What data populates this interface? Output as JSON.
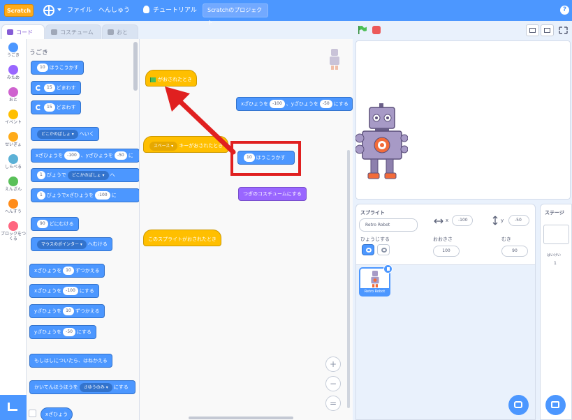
{
  "menu": {
    "logo": "Scratch",
    "file": "ファイル",
    "edit": "へんしゅう",
    "tutorials": "チュートリアル",
    "project_title": "Scratchのプロジェクト",
    "help": "?"
  },
  "tabs": {
    "code": "コード",
    "costumes": "コスチューム",
    "sounds": "おと"
  },
  "categories": [
    {
      "label": "うごき",
      "color": "#4c97ff"
    },
    {
      "label": "みため",
      "color": "#9966ff"
    },
    {
      "label": "おと",
      "color": "#cf63cf"
    },
    {
      "label": "イベント",
      "color": "#ffbf00"
    },
    {
      "label": "せいぎょ",
      "color": "#ffab19"
    },
    {
      "label": "しらべる",
      "color": "#5cb1d6"
    },
    {
      "label": "えんざん",
      "color": "#59c059"
    },
    {
      "label": "へんすう",
      "color": "#ff8c1a"
    },
    {
      "label": "ブロックをつくる",
      "color": "#ff6680"
    }
  ],
  "palette": {
    "title": "うごき",
    "move": {
      "value": "10",
      "text": "ほうこうかす"
    },
    "turn_right": {
      "value": "15",
      "text": "どまわす"
    },
    "turn_left": {
      "value": "15",
      "text": "どまわす"
    },
    "goto": {
      "dropdown": "どこかのばしょ ▾",
      "text": "へいく"
    },
    "goto_xy": {
      "t1": "xざひょうを",
      "x": "-100",
      "t2": "、yざひょうを",
      "y": "-50",
      "t3": "に"
    },
    "glide": {
      "value": "1",
      "t1": "びょうで",
      "dropdown": "どこかのばしょ ▾",
      "t2": "へ"
    },
    "glide_xy": {
      "value": "1",
      "t1": "びょうでxざひょうを",
      "x": "-100",
      "t2": "に"
    },
    "point_dir": {
      "value": "90",
      "text": "どにむける"
    },
    "point_towards": {
      "dropdown": "マウスのポインター ▾",
      "text": "へむける"
    },
    "change_x": {
      "t1": "xざひょうを",
      "value": "10",
      "t2": "ずつかえる"
    },
    "set_x": {
      "t1": "xざひょうを",
      "value": "-100",
      "t2": "にする"
    },
    "change_y": {
      "t1": "yざひょうを",
      "value": "10",
      "t2": "ずつかえる"
    },
    "set_y": {
      "t1": "yざひょうを",
      "value": "-50",
      "t2": "にする"
    },
    "bounce": "もしはしについたら、はねかえる",
    "rotation_style": {
      "t1": "かいてんほうほうを",
      "dropdown": "さゆうのみ ▾",
      "t2": "にする"
    },
    "x_reporter": "xざひょう"
  },
  "script": {
    "hat_flag": "がおされたとき",
    "goto_xy": {
      "t1": "xざひょうを",
      "x": "-100",
      "t2": "、yざひょうを",
      "y": "-50",
      "t3": "にする"
    },
    "hat_key": {
      "dropdown": "スペース ▾",
      "text": "キーがおされたとき"
    },
    "move": {
      "value": "10",
      "text": "ほうこうかす"
    },
    "next_costume": "つぎのコスチュームにする",
    "hat_sprite": "このスプライトがおされたとき"
  },
  "sprite_info": {
    "sprite_label": "スプライト",
    "sprite_name": "Retro Robot",
    "x": "-100",
    "y": "-50",
    "x_label": "x",
    "y_label": "y",
    "show_label": "ひょうじする",
    "size_label": "おおきさ",
    "size": "100",
    "direction_label": "むき",
    "direction": "90"
  },
  "sprite_list": [
    {
      "name": "Retro Robot"
    }
  ],
  "stage_panel": {
    "title": "ステージ",
    "backdrops_label": "はいけい",
    "backdrops_count": "1"
  },
  "zoom": {
    "in": "+",
    "out": "−",
    "reset": "="
  }
}
